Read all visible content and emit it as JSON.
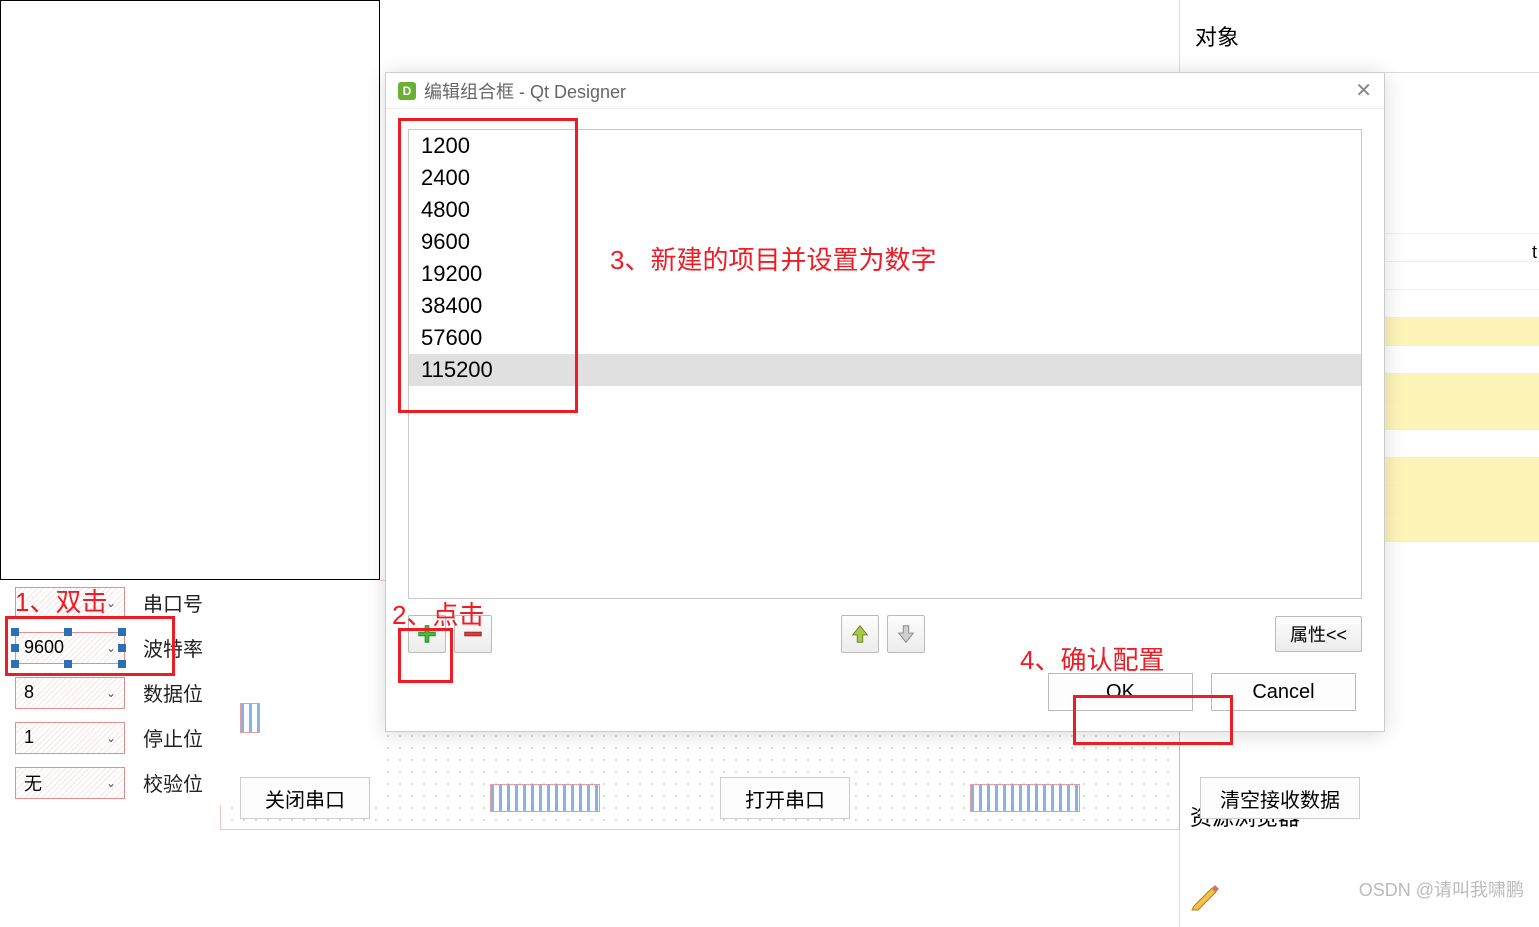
{
  "right_panel": {
    "header": "对象",
    "resource_browser": "资源浏览器",
    "truncated": "t"
  },
  "watermark": "OSDN @请叫我啸鹏",
  "form": {
    "port_label": "串口号",
    "baud_value": "9600",
    "baud_label": "波特率",
    "databits_value": "8",
    "databits_label": "数据位",
    "stopbits_value": "1",
    "stopbits_label": "停止位",
    "parity_value": "无",
    "parity_label": "校验位"
  },
  "buttons": {
    "close_port": "关闭串口",
    "open_port": "打开串口",
    "clear_rx": "清空接收数据"
  },
  "dialog": {
    "title": "编辑组合框 - Qt Designer",
    "items": [
      "1200",
      "2400",
      "4800",
      "9600",
      "19200",
      "38400",
      "57600",
      "115200"
    ],
    "props": "属性<<",
    "ok": "OK",
    "cancel": "Cancel"
  },
  "annotations": {
    "a1": "1、双击",
    "a2": "2、点击",
    "a3": "3、新建的项目并设置为数字",
    "a4": "4、确认配置"
  }
}
